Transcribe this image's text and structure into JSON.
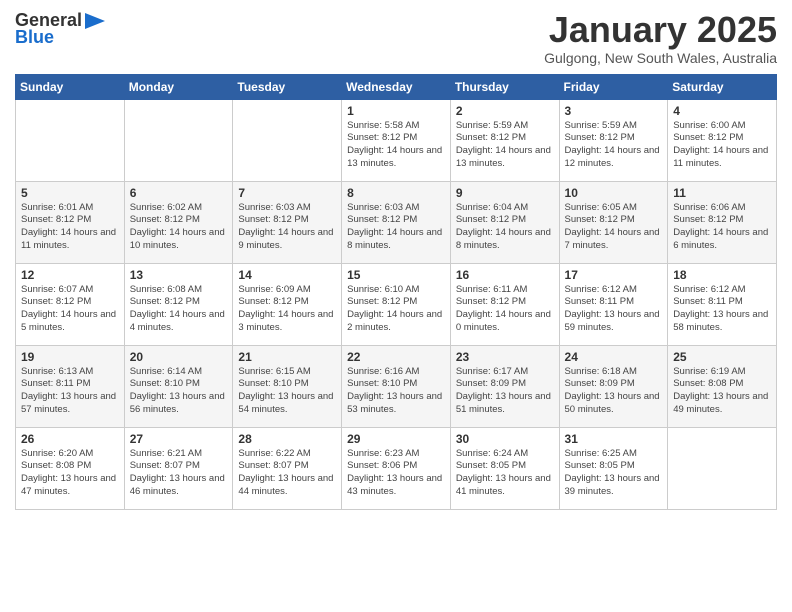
{
  "header": {
    "logo_general": "General",
    "logo_blue": "Blue",
    "month_title": "January 2025",
    "location": "Gulgong, New South Wales, Australia"
  },
  "days_of_week": [
    "Sunday",
    "Monday",
    "Tuesday",
    "Wednesday",
    "Thursday",
    "Friday",
    "Saturday"
  ],
  "weeks": [
    [
      {
        "day": "",
        "info": ""
      },
      {
        "day": "",
        "info": ""
      },
      {
        "day": "",
        "info": ""
      },
      {
        "day": "1",
        "info": "Sunrise: 5:58 AM\nSunset: 8:12 PM\nDaylight: 14 hours\nand 13 minutes."
      },
      {
        "day": "2",
        "info": "Sunrise: 5:59 AM\nSunset: 8:12 PM\nDaylight: 14 hours\nand 13 minutes."
      },
      {
        "day": "3",
        "info": "Sunrise: 5:59 AM\nSunset: 8:12 PM\nDaylight: 14 hours\nand 12 minutes."
      },
      {
        "day": "4",
        "info": "Sunrise: 6:00 AM\nSunset: 8:12 PM\nDaylight: 14 hours\nand 11 minutes."
      }
    ],
    [
      {
        "day": "5",
        "info": "Sunrise: 6:01 AM\nSunset: 8:12 PM\nDaylight: 14 hours\nand 11 minutes."
      },
      {
        "day": "6",
        "info": "Sunrise: 6:02 AM\nSunset: 8:12 PM\nDaylight: 14 hours\nand 10 minutes."
      },
      {
        "day": "7",
        "info": "Sunrise: 6:03 AM\nSunset: 8:12 PM\nDaylight: 14 hours\nand 9 minutes."
      },
      {
        "day": "8",
        "info": "Sunrise: 6:03 AM\nSunset: 8:12 PM\nDaylight: 14 hours\nand 8 minutes."
      },
      {
        "day": "9",
        "info": "Sunrise: 6:04 AM\nSunset: 8:12 PM\nDaylight: 14 hours\nand 8 minutes."
      },
      {
        "day": "10",
        "info": "Sunrise: 6:05 AM\nSunset: 8:12 PM\nDaylight: 14 hours\nand 7 minutes."
      },
      {
        "day": "11",
        "info": "Sunrise: 6:06 AM\nSunset: 8:12 PM\nDaylight: 14 hours\nand 6 minutes."
      }
    ],
    [
      {
        "day": "12",
        "info": "Sunrise: 6:07 AM\nSunset: 8:12 PM\nDaylight: 14 hours\nand 5 minutes."
      },
      {
        "day": "13",
        "info": "Sunrise: 6:08 AM\nSunset: 8:12 PM\nDaylight: 14 hours\nand 4 minutes."
      },
      {
        "day": "14",
        "info": "Sunrise: 6:09 AM\nSunset: 8:12 PM\nDaylight: 14 hours\nand 3 minutes."
      },
      {
        "day": "15",
        "info": "Sunrise: 6:10 AM\nSunset: 8:12 PM\nDaylight: 14 hours\nand 2 minutes."
      },
      {
        "day": "16",
        "info": "Sunrise: 6:11 AM\nSunset: 8:12 PM\nDaylight: 14 hours\nand 0 minutes."
      },
      {
        "day": "17",
        "info": "Sunrise: 6:12 AM\nSunset: 8:11 PM\nDaylight: 13 hours\nand 59 minutes."
      },
      {
        "day": "18",
        "info": "Sunrise: 6:12 AM\nSunset: 8:11 PM\nDaylight: 13 hours\nand 58 minutes."
      }
    ],
    [
      {
        "day": "19",
        "info": "Sunrise: 6:13 AM\nSunset: 8:11 PM\nDaylight: 13 hours\nand 57 minutes."
      },
      {
        "day": "20",
        "info": "Sunrise: 6:14 AM\nSunset: 8:10 PM\nDaylight: 13 hours\nand 56 minutes."
      },
      {
        "day": "21",
        "info": "Sunrise: 6:15 AM\nSunset: 8:10 PM\nDaylight: 13 hours\nand 54 minutes."
      },
      {
        "day": "22",
        "info": "Sunrise: 6:16 AM\nSunset: 8:10 PM\nDaylight: 13 hours\nand 53 minutes."
      },
      {
        "day": "23",
        "info": "Sunrise: 6:17 AM\nSunset: 8:09 PM\nDaylight: 13 hours\nand 51 minutes."
      },
      {
        "day": "24",
        "info": "Sunrise: 6:18 AM\nSunset: 8:09 PM\nDaylight: 13 hours\nand 50 minutes."
      },
      {
        "day": "25",
        "info": "Sunrise: 6:19 AM\nSunset: 8:08 PM\nDaylight: 13 hours\nand 49 minutes."
      }
    ],
    [
      {
        "day": "26",
        "info": "Sunrise: 6:20 AM\nSunset: 8:08 PM\nDaylight: 13 hours\nand 47 minutes."
      },
      {
        "day": "27",
        "info": "Sunrise: 6:21 AM\nSunset: 8:07 PM\nDaylight: 13 hours\nand 46 minutes."
      },
      {
        "day": "28",
        "info": "Sunrise: 6:22 AM\nSunset: 8:07 PM\nDaylight: 13 hours\nand 44 minutes."
      },
      {
        "day": "29",
        "info": "Sunrise: 6:23 AM\nSunset: 8:06 PM\nDaylight: 13 hours\nand 43 minutes."
      },
      {
        "day": "30",
        "info": "Sunrise: 6:24 AM\nSunset: 8:05 PM\nDaylight: 13 hours\nand 41 minutes."
      },
      {
        "day": "31",
        "info": "Sunrise: 6:25 AM\nSunset: 8:05 PM\nDaylight: 13 hours\nand 39 minutes."
      },
      {
        "day": "",
        "info": ""
      }
    ]
  ]
}
